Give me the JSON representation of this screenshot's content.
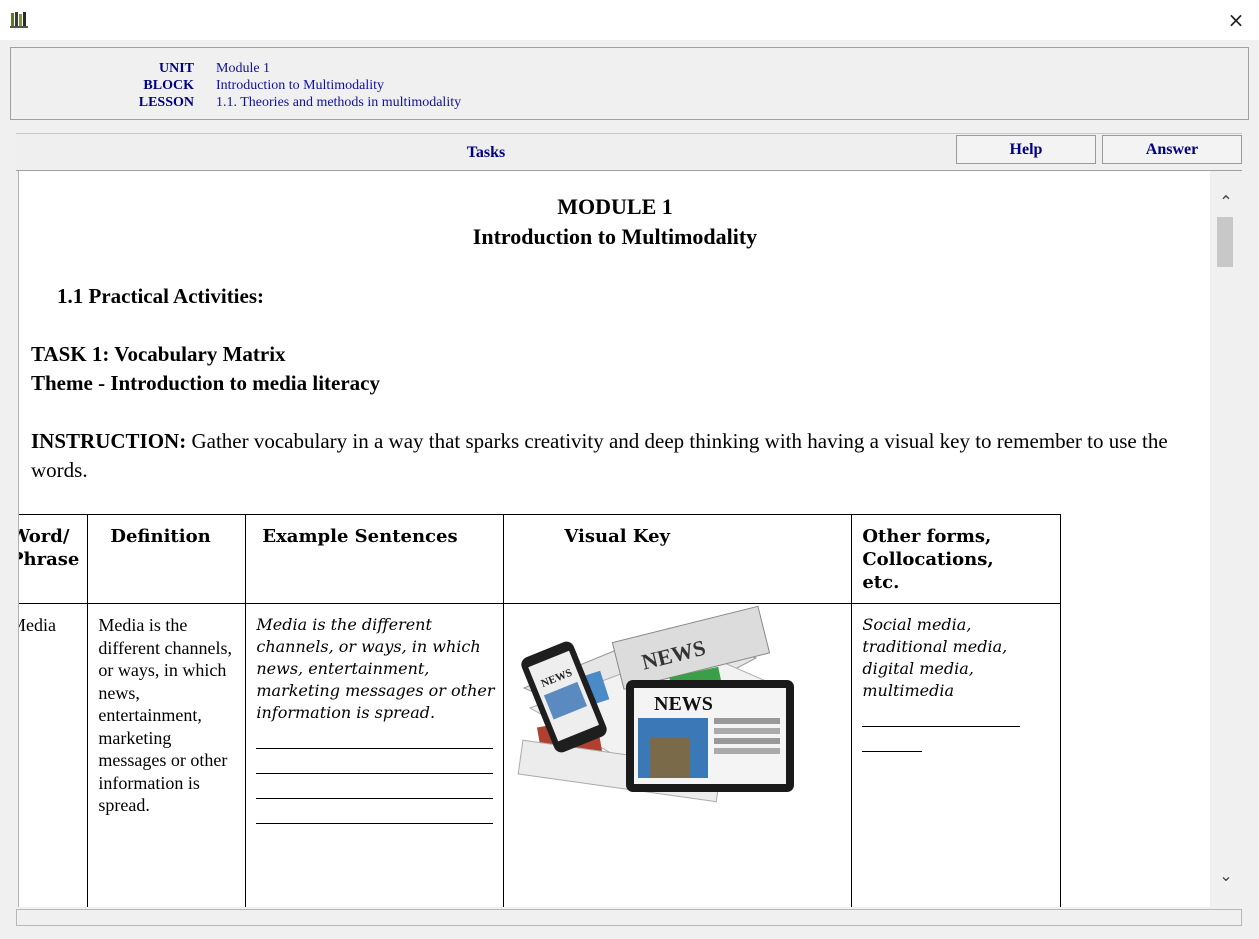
{
  "window": {
    "close_glyph": "×",
    "app_icon": "book-icon"
  },
  "info": {
    "unit_label": "UNIT",
    "unit_value": "Module 1",
    "block_label": "BLOCK",
    "block_value": "Introduction to Multimodality",
    "lesson_label": "LESSON",
    "lesson_value": "1.1. Theories and methods in multimodality"
  },
  "toolbar": {
    "tasks_label": "Tasks",
    "help_label": "Help",
    "answer_label": "Answer"
  },
  "scrollbar": {
    "up_glyph": "⌃",
    "down_glyph": "⌄"
  },
  "doc": {
    "module_title": "MODULE 1",
    "module_subtitle": "Introduction to Multimodality",
    "practical": "1.1 Practical Activities:",
    "task_title": "TASK 1: Vocabulary Matrix",
    "theme": "Theme - Introduction to media literacy",
    "instruction_label": "INSTRUCTION:",
    "instruction_text": " Gather vocabulary in a way that sparks creativity and deep thinking with having a visual key to remember to use the words."
  },
  "table": {
    "headers": [
      "Word/ Phrase",
      "Definition",
      "Example Sentences",
      "Visual Key",
      "Other forms, Collocations, etc."
    ],
    "row": {
      "word": "Media",
      "definition": "Media is the different channels, or ways, in which news, entertainment, marketing messages or other information is spread.",
      "example": "Media is the different channels, or ways, in which news, entertainment, marketing messages or other information is spread.",
      "visual_labels": [
        "NEWS",
        "NEWS",
        "NEWS"
      ],
      "other": "Social media, traditional media, digital media, multimedia"
    }
  },
  "colors": {
    "accent_navy": "#000080",
    "info_value": "#1010a0",
    "panel_bg": "#f0f0f0"
  }
}
